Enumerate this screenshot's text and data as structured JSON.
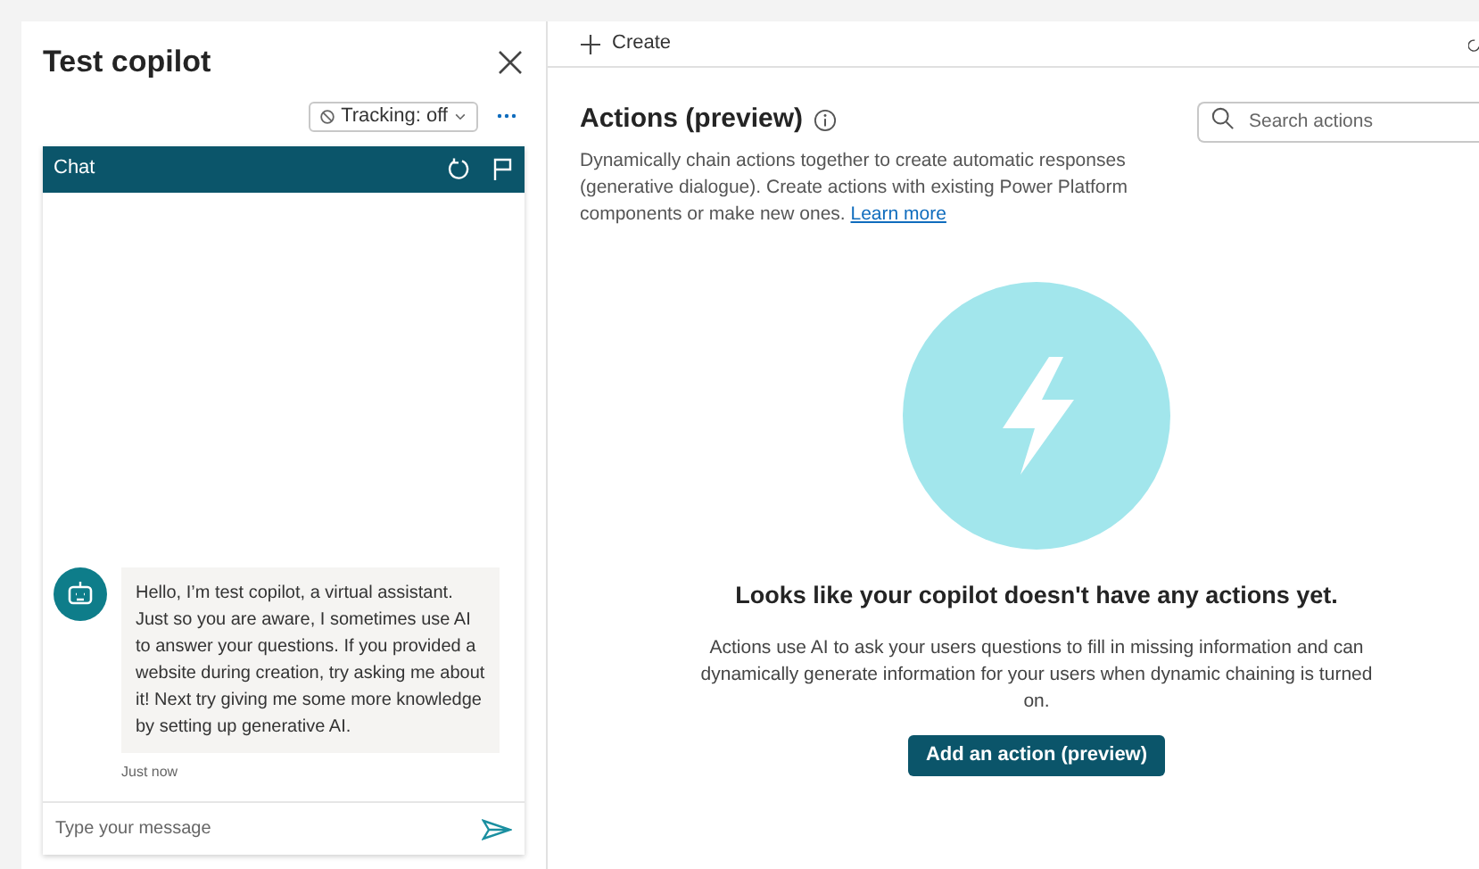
{
  "test_panel": {
    "title": "Test copilot",
    "tracking": "Tracking: off",
    "chat": {
      "title": "Chat",
      "messages": [
        {
          "text": "Hello, I’m test copilot, a virtual assistant. Just so you are aware, I sometimes use AI to answer your questions. If you provided a website during creation, try asking me about it! Next try giving me some more knowledge by setting up generative AI.",
          "time": "Just now"
        }
      ],
      "input": {
        "placeholder": "Type your message"
      }
    }
  },
  "toolbar": {
    "create": "Create"
  },
  "actions": {
    "title": "Actions (preview)",
    "description": "Dynamically chain actions together to create automatic responses (generative dialogue). Create actions with existing Power Platform components or make new ones.",
    "link": "Learn more",
    "search": {
      "placeholder": "Search actions"
    },
    "empty": {
      "heading": "Looks like your copilot doesn't have any actions yet.",
      "text": "Actions use AI to ask your users questions to fill in missing information and can dynamically generate information for your users when dynamic chaining is turned on.",
      "button": "Add an action (preview)"
    }
  }
}
